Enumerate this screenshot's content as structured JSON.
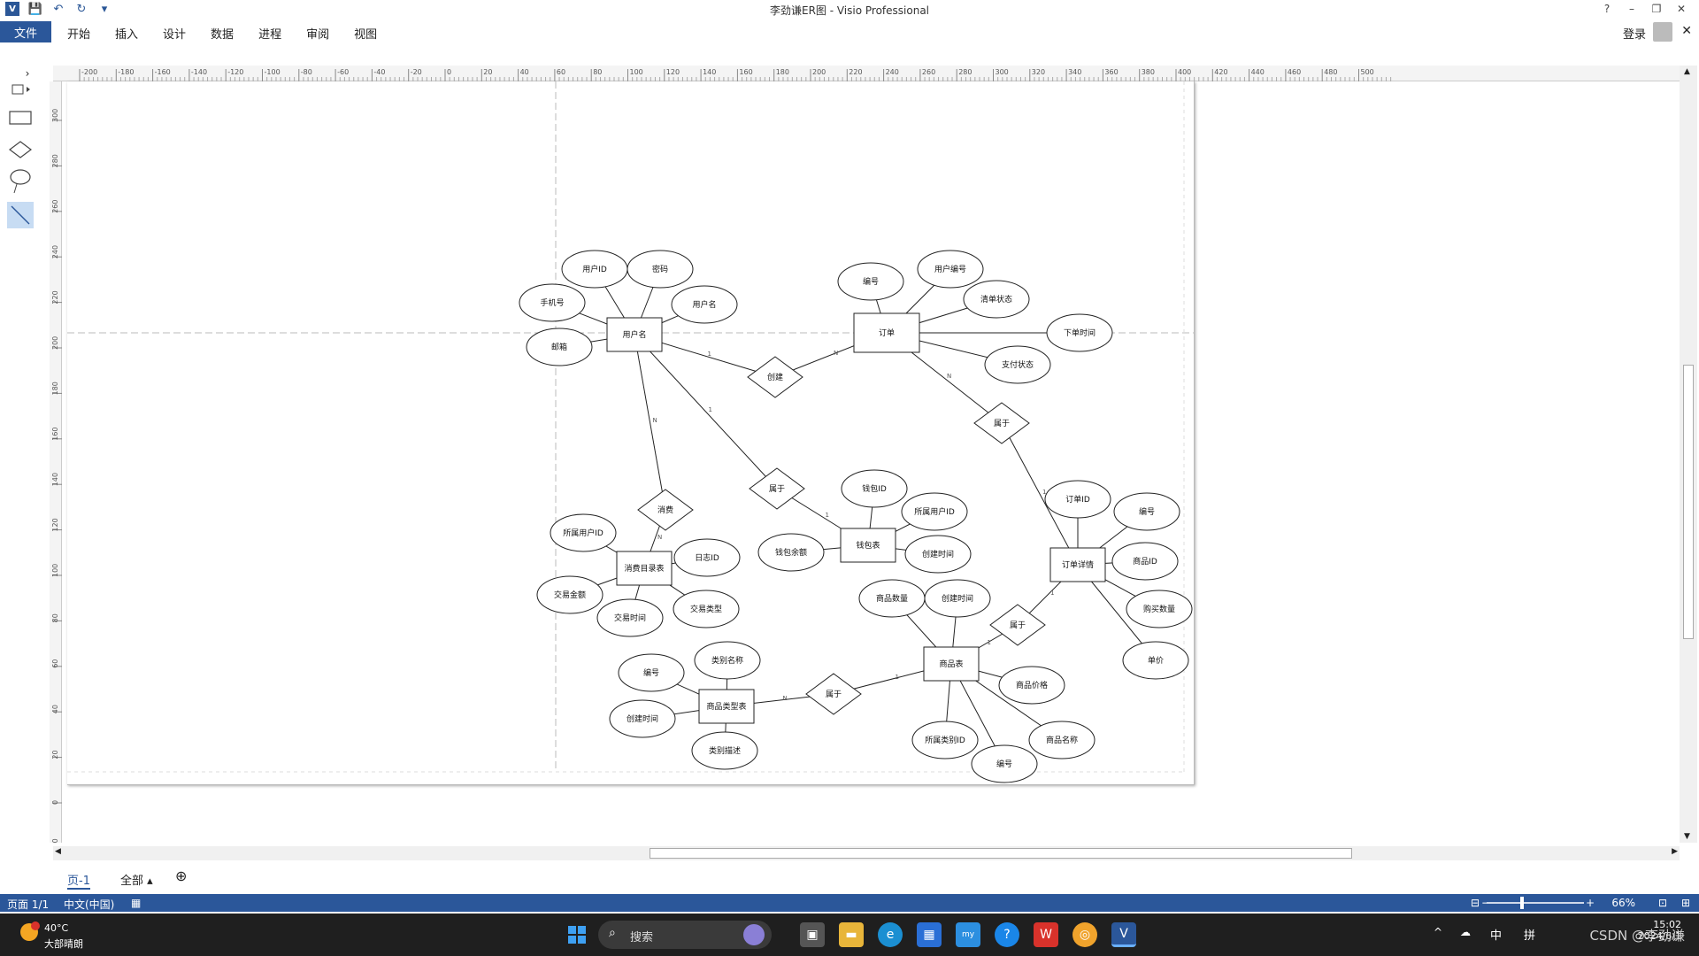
{
  "window": {
    "title": "李劲谦ER图 - Visio Professional",
    "help": "?",
    "minimize": "–",
    "restore": "❐",
    "close": "✕"
  },
  "menu": {
    "file": "文件",
    "tabs": [
      "开始",
      "插入",
      "设计",
      "数据",
      "进程",
      "审阅",
      "视图"
    ],
    "login": "登录"
  },
  "ruler": {
    "h_ticks": [
      "-200",
      "-180",
      "-160",
      "-140",
      "-120",
      "-100",
      "-80",
      "-60",
      "-40",
      "-20",
      "0",
      "20",
      "40",
      "60",
      "80",
      "100",
      "120",
      "140",
      "160",
      "180",
      "200",
      "220",
      "240",
      "260",
      "280",
      "300",
      "320",
      "340",
      "360",
      "380",
      "400",
      "420",
      "440",
      "460",
      "480",
      "500"
    ],
    "v_ticks": [
      "300",
      "280",
      "260",
      "240",
      "220",
      "200",
      "180",
      "160",
      "140",
      "120",
      "100",
      "80",
      "60",
      "40",
      "20",
      "0",
      "-20"
    ]
  },
  "diagram": {
    "entities": [
      "用户名",
      "订单",
      "钱包表",
      "消费目录表",
      "订单详情",
      "商品表",
      "商品类型表"
    ],
    "relations": [
      "创建",
      "属于",
      "属于",
      "消费",
      "属于",
      "属于"
    ],
    "attributes": [
      "用户ID",
      "密码",
      "手机号",
      "用户名",
      "邮箱",
      "编号",
      "用户编号",
      "清单状态",
      "下单时间",
      "支付状态",
      "钱包ID",
      "所属用户ID",
      "钱包余额",
      "创建时间",
      "所属用户ID",
      "日志ID",
      "交易金额",
      "交易时间",
      "交易类型",
      "订单ID",
      "编号",
      "商品ID",
      "购买数量",
      "单价",
      "商品数量",
      "创建时间",
      "商品价格",
      "所属类别ID",
      "编号",
      "商品名称",
      "编号",
      "类别名称",
      "创建时间",
      "类别描述"
    ],
    "card_labels": [
      "1",
      "N",
      "1",
      "1",
      "N",
      "1",
      "N",
      "N",
      "1",
      "1",
      "N",
      "1"
    ]
  },
  "pagetabs": {
    "page1": "页-1",
    "all": "全部 ▴",
    "add": "⊕"
  },
  "status": {
    "page": "页面 1/1",
    "lang": "中文(中国)",
    "zoom": "66%"
  },
  "taskbar": {
    "temp": "40°C",
    "condition": "大部晴朗",
    "search": "搜索",
    "ime1": "中",
    "ime2": "拼",
    "time": "15:02",
    "date": "2024/6/1",
    "watermark": "CSDN @李劲谦"
  }
}
